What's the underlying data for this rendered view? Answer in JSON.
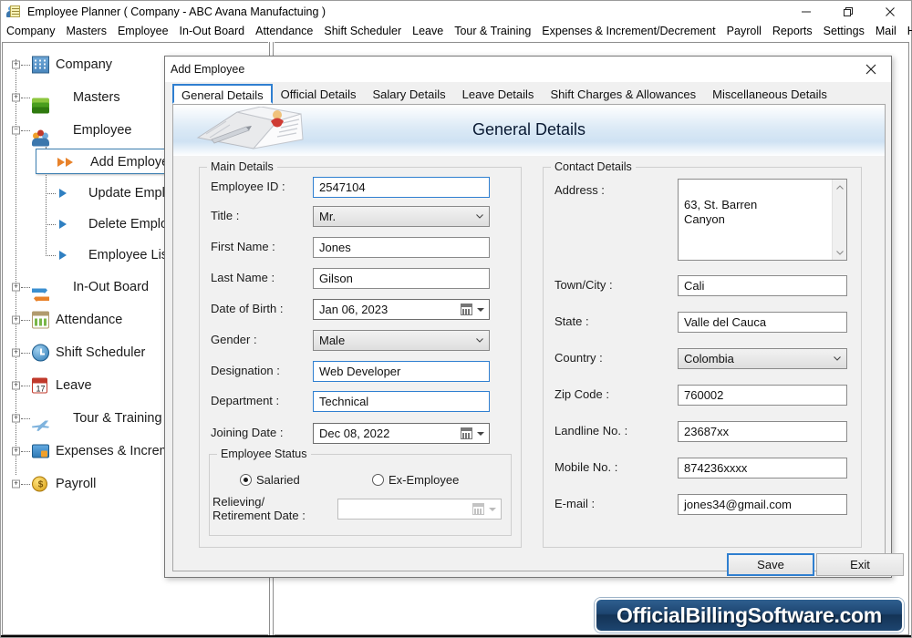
{
  "window": {
    "title": "Employee Planner ( Company - ABC Avana Manufactuing )",
    "app_icon": "employee-planner-icon",
    "minimize": "—",
    "restore": "❐",
    "close": "✕"
  },
  "menubar": {
    "items": [
      {
        "label": "Company"
      },
      {
        "label": "Masters"
      },
      {
        "label": "Employee"
      },
      {
        "label": "In-Out Board"
      },
      {
        "label": "Attendance"
      },
      {
        "label": "Shift Scheduler"
      },
      {
        "label": "Leave"
      },
      {
        "label": "Tour & Training"
      },
      {
        "label": "Expenses & Increment/Decrement"
      },
      {
        "label": "Payroll"
      },
      {
        "label": "Reports"
      },
      {
        "label": "Settings"
      },
      {
        "label": "Mail"
      },
      {
        "label": "Help"
      }
    ]
  },
  "sidebar": {
    "nodes": [
      {
        "label": "Company",
        "icon": "building-icon",
        "expander": "+",
        "level": 0
      },
      {
        "label": "Masters",
        "icon": "layers-icon",
        "expander": "+",
        "level": 0
      },
      {
        "label": "Employee",
        "icon": "people-icon",
        "expander": "-",
        "level": 0
      },
      {
        "label": "Add Employee",
        "icon": "double-arrow-icon",
        "level": 1,
        "selected": true
      },
      {
        "label": "Update Employee",
        "icon": "arrow-icon",
        "level": 1
      },
      {
        "label": "Delete Employee",
        "icon": "arrow-icon",
        "level": 1
      },
      {
        "label": "Employee List",
        "icon": "arrow-icon",
        "level": 1
      },
      {
        "label": "In-Out Board",
        "icon": "in-out-icon",
        "expander": "+",
        "level": 0
      },
      {
        "label": "Attendance",
        "icon": "attendance-icon",
        "expander": "+",
        "level": 0
      },
      {
        "label": "Shift Scheduler",
        "icon": "clock-icon",
        "expander": "+",
        "level": 0
      },
      {
        "label": "Leave",
        "icon": "calendar-icon",
        "expander": "+",
        "level": 0,
        "icon_text": "17"
      },
      {
        "label": "Tour & Training",
        "icon": "plane-icon",
        "expander": "+",
        "level": 0
      },
      {
        "label": "Expenses & Increme",
        "icon": "wallet-icon",
        "expander": "+",
        "level": 0
      },
      {
        "label": "Payroll",
        "icon": "coin-icon",
        "expander": "+",
        "level": 0
      }
    ]
  },
  "dialog": {
    "title": "Add Employee",
    "close_icon": "close-icon",
    "tabs": [
      {
        "label": "General Details",
        "active": true
      },
      {
        "label": "Official Details",
        "active": false
      },
      {
        "label": "Salary Details",
        "active": false
      },
      {
        "label": "Leave Details",
        "active": false
      },
      {
        "label": "Shift Charges & Allowances",
        "active": false
      },
      {
        "label": "Miscellaneous Details",
        "active": false
      }
    ],
    "banner": {
      "title": "General Details",
      "image": "notebook-pen-icon"
    },
    "main_details": {
      "legend": "Main Details",
      "employee_id_label": "Employee ID :",
      "employee_id_value": "2547104",
      "title_label": "Title :",
      "title_value": "Mr.",
      "first_name_label": "First Name :",
      "first_name_value": "Jones",
      "last_name_label": "Last Name :",
      "last_name_value": "Gilson",
      "dob_label": "Date of Birth :",
      "dob_value": "Jan  06, 2023",
      "gender_label": "Gender :",
      "gender_value": "Male",
      "designation_label": "Designation :",
      "designation_value": "Web Developer",
      "department_label": "Department :",
      "department_value": "Technical",
      "joining_date_label": "Joining Date :",
      "joining_date_value": "Dec 08, 2022"
    },
    "employee_status": {
      "legend": "Employee Status",
      "salaried_label": "Salaried",
      "salaried_checked": true,
      "ex_employee_label": "Ex-Employee",
      "ex_employee_checked": false,
      "relieving_label_line1": "Relieving/",
      "relieving_label_line2": "Retirement Date :",
      "relieving_value": ""
    },
    "contact_details": {
      "legend": "Contact Details",
      "address_label": "Address :",
      "address_value": "63, St. Barren\nCanyon",
      "town_label": "Town/City :",
      "town_value": "Cali",
      "state_label": "State :",
      "state_value": "Valle del Cauca",
      "country_label": "Country :",
      "country_value": "Colombia",
      "zip_label": "Zip Code :",
      "zip_value": "760002",
      "landline_label": "Landline No. :",
      "landline_value": "23687xx",
      "mobile_label": "Mobile No. :",
      "mobile_value": "874236xxxx",
      "email_label": "E-mail :",
      "email_value": "jones34@gmail.com"
    },
    "buttons": {
      "save": "Save",
      "exit": "Exit"
    }
  },
  "watermark": {
    "text": "OfficialBillingSoftware.com"
  },
  "colors": {
    "accent_blue": "#2f7fd0",
    "selected_arrow_orange": "#e8822a",
    "watermark_bg": "#1d4570",
    "banner_blue": "#cfe2f3"
  }
}
